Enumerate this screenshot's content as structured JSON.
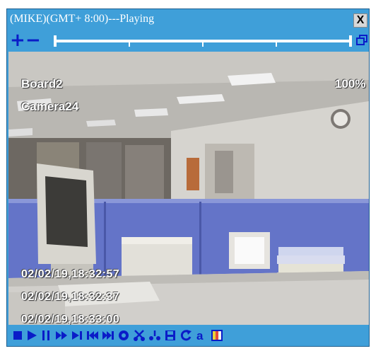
{
  "window": {
    "title": "(MIKE)(GMT+ 8:00)---Playing",
    "close_label": "X"
  },
  "zoom": {
    "zoom_in_label": "+",
    "zoom_out_label": "−"
  },
  "video": {
    "board": "Board2",
    "camera": "Camera24",
    "zoom_level": "100%",
    "timestamps": [
      "02/02/19,18:32:57",
      "02/02/19,18:32:37",
      "02/02/19,18:33:00"
    ]
  },
  "controls": [
    {
      "name": "stop-icon"
    },
    {
      "name": "play-icon"
    },
    {
      "name": "pause-icon"
    },
    {
      "name": "fast-forward-icon"
    },
    {
      "name": "step-forward-icon"
    },
    {
      "name": "skip-back-icon"
    },
    {
      "name": "skip-forward-icon"
    },
    {
      "name": "settings-icon"
    },
    {
      "name": "cut-icon"
    },
    {
      "name": "snip-icon"
    },
    {
      "name": "save-icon"
    },
    {
      "name": "refresh-icon"
    },
    {
      "name": "audio-icon"
    },
    {
      "name": "color-icon"
    }
  ],
  "colors": {
    "window_blue": "#3f9fd9",
    "icon_blue": "#0a1cc8"
  }
}
